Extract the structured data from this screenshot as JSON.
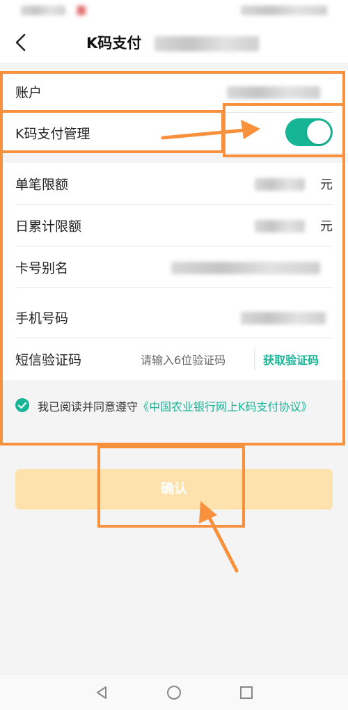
{
  "header": {
    "title": "K码支付"
  },
  "account": {
    "label": "账户"
  },
  "k_pay": {
    "label": "K码支付管理",
    "enabled": true
  },
  "limits": {
    "single_label": "单笔限额",
    "single_unit": "元",
    "daily_label": "日累计限额",
    "daily_unit": "元"
  },
  "card_alias": {
    "label": "卡号别名"
  },
  "phone": {
    "label": "手机号码"
  },
  "sms": {
    "label": "短信验证码",
    "placeholder": "请输入6位验证码",
    "get_code_label": "获取验证码"
  },
  "agreement": {
    "text": "我已阅读并同意遵守",
    "link": "《中国农业银行网上K码支付协议》",
    "checked": true
  },
  "confirm": {
    "label": "确认"
  },
  "colors": {
    "accent": "#16b596",
    "confirm_disabled": "#fde2ad",
    "annotation": "#f7913d"
  },
  "icons": {
    "back": "back-icon",
    "nav_back": "triangle-back-icon",
    "nav_home": "circle-home-icon",
    "nav_recent": "square-recent-icon"
  }
}
